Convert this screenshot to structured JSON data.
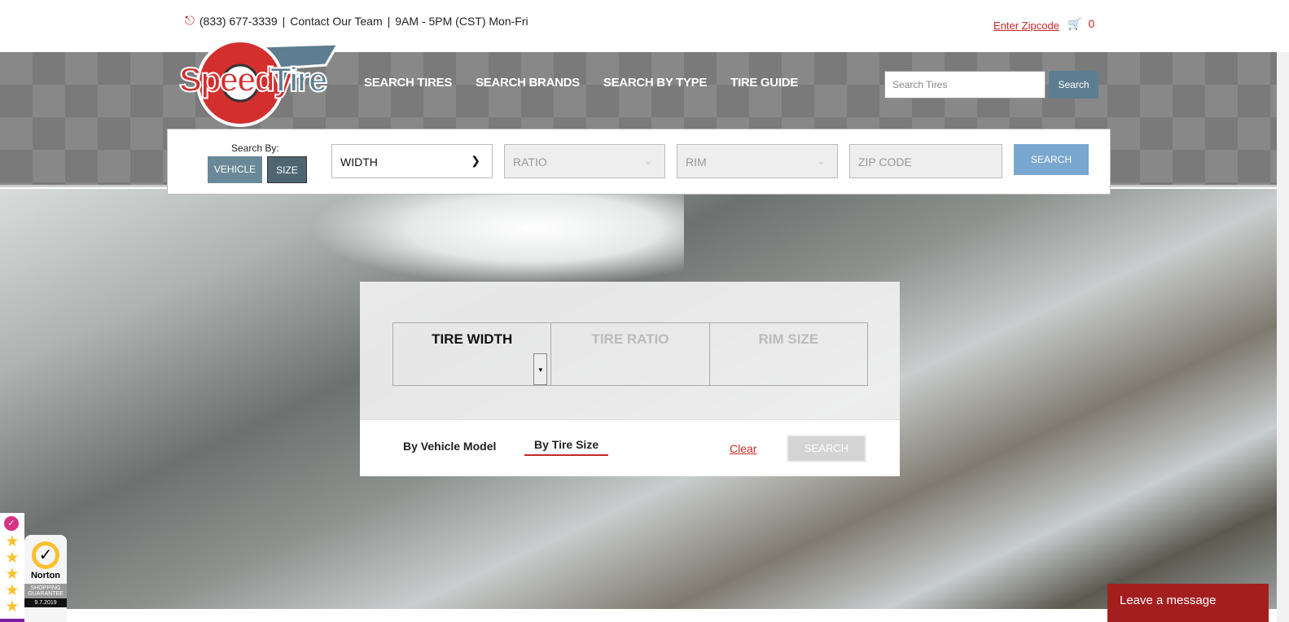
{
  "topbar": {
    "phone": "(833) 677-3339",
    "sep1": "|",
    "contact": "Contact Our Team",
    "sep2": "|",
    "hours": "9AM - 5PM (CST) Mon-Fri",
    "zipcode_link": "Enter Zipcode",
    "cart_count": "0"
  },
  "logo": {
    "text": "SpeedyTire"
  },
  "nav": {
    "items": [
      "SEARCH TIRES",
      "SEARCH BRANDS",
      "SEARCH BY TYPE",
      "TIRE GUIDE"
    ]
  },
  "header_search": {
    "placeholder": "Search Tires",
    "button": "Search"
  },
  "search_bar": {
    "label": "Search By:",
    "vehicle": "VEHICLE",
    "size": "SIZE",
    "width": "WIDTH",
    "ratio": "RATIO",
    "rim": "RIM",
    "zip_placeholder": "ZIP CODE",
    "search": "SEARCH"
  },
  "panel": {
    "cells": [
      "TIRE WIDTH",
      "TIRE RATIO",
      "RIM SIZE"
    ],
    "tab_vehicle": "By Vehicle Model",
    "tab_size": "By Tire Size",
    "clear": "Clear",
    "search": "SEARCH"
  },
  "chat": {
    "label": "Leave a message"
  },
  "norton": {
    "brand": "Norton",
    "line1": "SHOPPING",
    "line2": "GUARANTEE",
    "date": "9.7.2019"
  },
  "rating": {
    "stars": 4.5
  },
  "colors": {
    "accent": "#c62828",
    "slate": "#5d7e90",
    "chat": "#a31f1f"
  }
}
